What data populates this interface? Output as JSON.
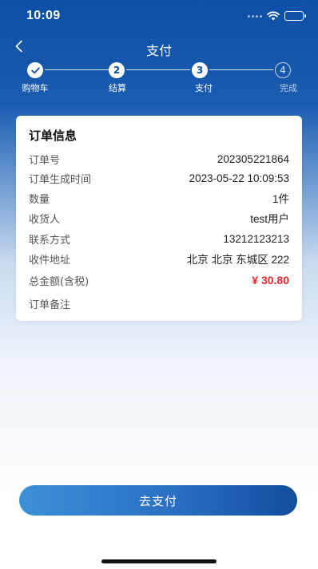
{
  "status_bar": {
    "time": "10:09"
  },
  "nav": {
    "title": "支付"
  },
  "steps": [
    {
      "number": "✓",
      "label": "购物车",
      "state": "done"
    },
    {
      "number": "2",
      "label": "结算",
      "state": "done"
    },
    {
      "number": "3",
      "label": "支付",
      "state": "current"
    },
    {
      "number": "4",
      "label": "完成",
      "state": "pending"
    }
  ],
  "order_info": {
    "title": "订单信息",
    "rows": [
      {
        "label": "订单号",
        "value": "202305221864"
      },
      {
        "label": "订单生成时间",
        "value": "2023-05-22 10:09:53"
      },
      {
        "label": "数量",
        "value": "1件"
      },
      {
        "label": "收货人",
        "value": "test用户"
      },
      {
        "label": "联系方式",
        "value": "13212123213"
      },
      {
        "label": "收件地址",
        "value": "北京 北京 东城区 222"
      },
      {
        "label": "总金额(含税)",
        "value": "¥ 30.80"
      },
      {
        "label": "订单备注",
        "value": ""
      }
    ]
  },
  "actions": {
    "pay_label": "去支付"
  },
  "colors": {
    "primary": "#0d4fa4",
    "price": "#e8262d"
  }
}
